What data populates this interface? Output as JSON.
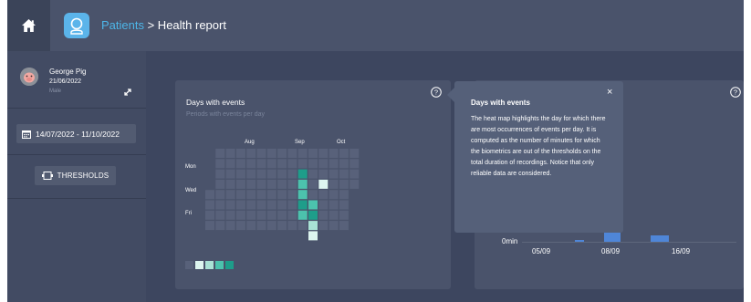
{
  "header": {
    "home_icon": "home-icon",
    "logo_icon": "patient-app-icon",
    "breadcrumb_link": "Patients",
    "breadcrumb_current": " > Health report"
  },
  "sidebar": {
    "patient": {
      "name": "George Pig",
      "dob": "21/06/2022",
      "sex": "Male"
    },
    "date_range": "14/07/2022 - 11/10/2022",
    "thresholds_label": "THRESHOLDS"
  },
  "heatmap_card": {
    "title": "Days with events",
    "subtitle": "Periods with events per day",
    "months": [
      "Aug",
      "Sep",
      "Oct"
    ],
    "day_labels": [
      "Mon",
      "Wed",
      "Fri"
    ],
    "colors": {
      "background": "#3d465f",
      "empty": "#58617a",
      "level1": "#ddf5ef",
      "level2": "#a9e2d5",
      "level3": "#4cc2ad",
      "level4": "#1e9d8a"
    }
  },
  "chart_card": {
    "y_label": "0min",
    "x_ticks": [
      "05/09",
      "08/09",
      "16/09"
    ],
    "bar_color": "#4f86d8"
  },
  "tooltip": {
    "title": "Days with events",
    "close": "×",
    "body": "The heat map highlights the day for which there are most occurrences of events per day. It is computed as the number of minutes for which the biometrics are out of the thresholds on the total duration of recordings. Notice that only reliable data are considered."
  }
}
